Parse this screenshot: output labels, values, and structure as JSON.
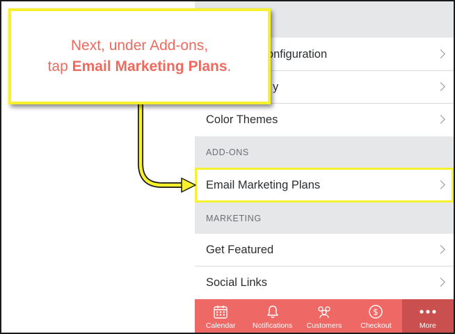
{
  "callout": {
    "line1": "Next, under Add-ons,",
    "line2_prefix": "tap",
    "line2_bold": "Email Marketing Plans",
    "line2_suffix": "."
  },
  "menu": {
    "rows_top": [
      {
        "label": "Configuration",
        "name": "menu-row-configuration"
      },
      {
        "label": "y",
        "name": "menu-row-partially-hidden"
      },
      {
        "label": "Color Themes",
        "name": "menu-row-color-themes"
      }
    ],
    "addons_header": "ADD-ONS",
    "email_marketing": "Email Marketing Plans",
    "marketing_header": "MARKETING",
    "get_featured": "Get Featured",
    "social_links": "Social Links"
  },
  "tabs": [
    {
      "label": "Calendar",
      "icon": "calendar-icon"
    },
    {
      "label": "Notifications",
      "icon": "bell-icon"
    },
    {
      "label": "Customers",
      "icon": "customers-icon"
    },
    {
      "label": "Checkout",
      "icon": "dollar-icon"
    },
    {
      "label": "More",
      "icon": "more-dots-icon"
    }
  ],
  "colors": {
    "tab_bar": "#ee6866",
    "tab_active": "#c9504e",
    "highlight": "#f7f02c",
    "callout_text": "#ef6a5e"
  }
}
